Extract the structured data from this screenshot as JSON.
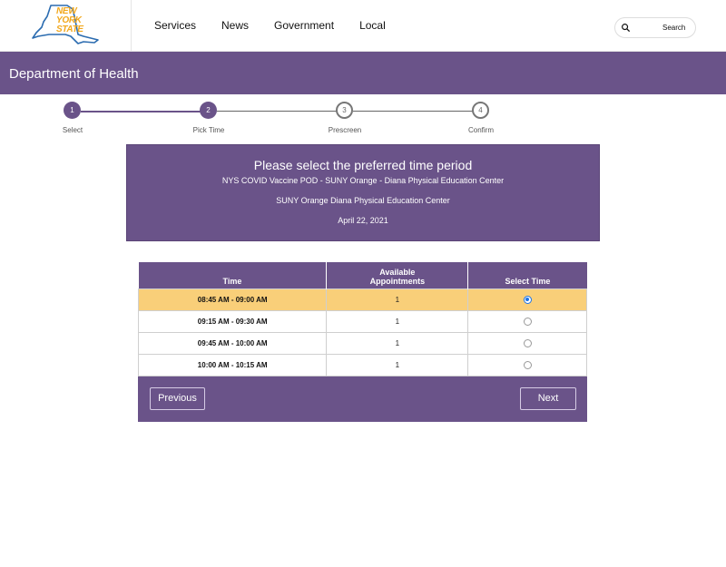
{
  "header": {
    "logo_lines": [
      "NEW",
      "YORK",
      "STATE"
    ],
    "nav": [
      "Services",
      "News",
      "Government",
      "Local"
    ],
    "search_label": "Search"
  },
  "department": {
    "title": "Department of Health"
  },
  "stepper": {
    "steps": [
      {
        "number": "1",
        "label": "Select",
        "status": "done"
      },
      {
        "number": "2",
        "label": "Pick Time",
        "status": "done"
      },
      {
        "number": "3",
        "label": "Prescreen",
        "status": "todo"
      },
      {
        "number": "4",
        "label": "Confirm",
        "status": "todo"
      }
    ]
  },
  "info": {
    "title": "Please select the preferred time period",
    "line1": "NYS COVID Vaccine POD - SUNY Orange - Diana Physical Education Center",
    "line2": "SUNY Orange Diana Physical Education Center",
    "line3": "April 22, 2021"
  },
  "table": {
    "headers": [
      "Time",
      "Available Appointments",
      "Select Time"
    ],
    "rows": [
      {
        "time": "08:45 AM - 09:00 AM",
        "available": "1",
        "selected": true
      },
      {
        "time": "09:15 AM - 09:30 AM",
        "available": "1",
        "selected": false
      },
      {
        "time": "09:45 AM - 10:00 AM",
        "available": "1",
        "selected": false
      },
      {
        "time": "10:00 AM - 10:15 AM",
        "available": "1",
        "selected": false
      }
    ]
  },
  "buttons": {
    "previous": "Previous",
    "next": "Next"
  },
  "colors": {
    "brand_purple": "#6a5389",
    "selected_row": "#f9cf79",
    "logo_gold": "#f2a81d",
    "logo_blue": "#2b6cb0"
  }
}
